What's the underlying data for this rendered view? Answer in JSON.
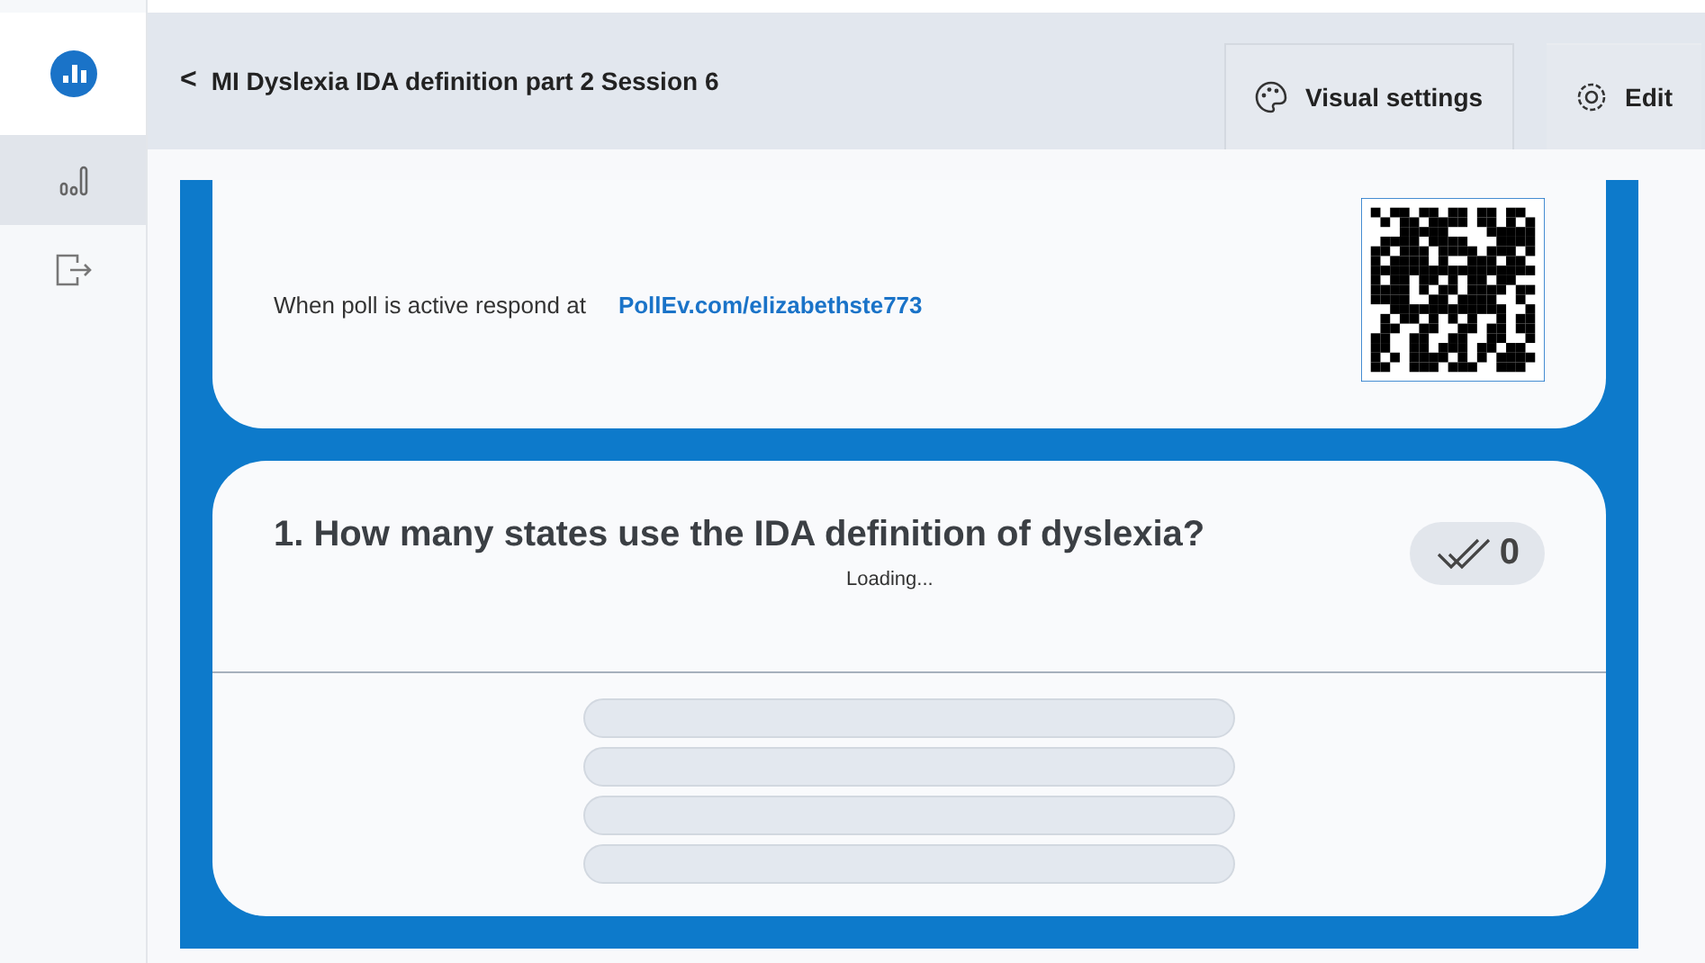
{
  "sidebar": {
    "items": [
      {
        "kind": "chart",
        "selected": true
      },
      {
        "kind": "exit",
        "selected": false
      }
    ]
  },
  "header": {
    "back": "<",
    "title": "MI Dyslexia IDA definition part 2 Session 6",
    "buttons": [
      {
        "kind": "palette",
        "label": "Visual settings"
      },
      {
        "kind": "gear",
        "label": "Edit"
      }
    ]
  },
  "respond": {
    "text": "When poll is active respond at",
    "link": "PollEv.com/elizabethste773"
  },
  "question": {
    "title": "1. How many states use the IDA definition of dyslexia?",
    "loading": "Loading...",
    "responses": "0"
  }
}
